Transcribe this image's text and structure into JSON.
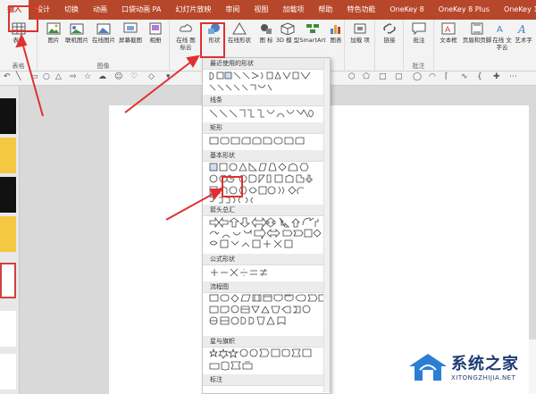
{
  "tabs": [
    "插入",
    "设计",
    "切换",
    "动画",
    "口袋动画 PA",
    "幻灯片放映",
    "审阅",
    "视图",
    "加载项",
    "帮助",
    "特色功能",
    "OneKey 8",
    "OneKey 8 Plus",
    "OneKey 10"
  ],
  "active_tab": "插入",
  "ribbon_buttons": {
    "table": "表格",
    "picture": "图片",
    "online_picture": "联机图片",
    "online_picture2": "在线图片",
    "screenshot": "屏幕截图",
    "album": "相册",
    "online_icons": "在线\n图标云",
    "shapes": "形状",
    "online_shapes": "在线形状",
    "icons": "图\n标",
    "model3d": "3D 模\n型",
    "smartart": "SmartArt",
    "chart": "图表",
    "addins": "加载\n项",
    "link": "链接",
    "comment": "批注",
    "textbox": "文本框",
    "header_footer": "页眉和页脚",
    "online_text": "在线\n文字云",
    "wordart": "艺术字"
  },
  "group_labels": {
    "tables": "表格",
    "images": "图像",
    "comments": "批注"
  },
  "shapes_panel": {
    "sections": [
      "最近使用的形状",
      "线条",
      "矩形",
      "基本形状",
      "箭头总汇",
      "公式形状",
      "流程图",
      "星与旗帜",
      "标注"
    ]
  },
  "watermark": {
    "brand": "系统之家",
    "url": "XITONGZHIJIA.NET"
  },
  "colors": {
    "accent": "#b7472a",
    "highlight": "#e03030",
    "ribbon_bg": "#f3f3f3"
  }
}
